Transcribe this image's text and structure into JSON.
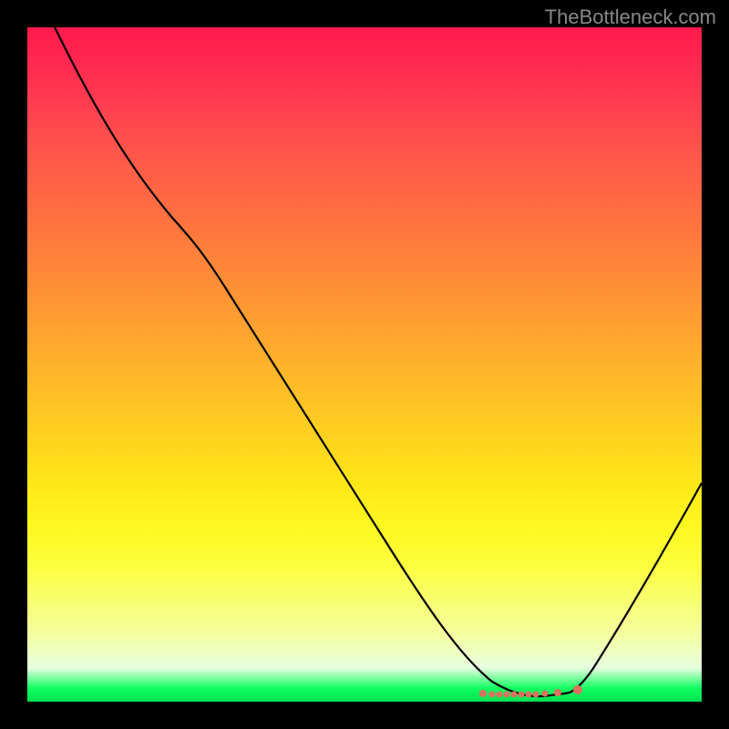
{
  "watermark": "TheBottleneck.com",
  "chart_data": {
    "type": "line",
    "title": "",
    "xlabel": "",
    "ylabel": "",
    "xlim": [
      0,
      100
    ],
    "ylim": [
      0,
      100
    ],
    "background_gradient": {
      "top": "#ff1a4d",
      "middle": "#ffd020",
      "bottom": "#00e050"
    },
    "series": [
      {
        "name": "curve",
        "color": "#000000",
        "x": [
          4,
          10,
          16,
          22,
          28,
          34,
          40,
          46,
          52,
          58,
          64,
          68,
          72,
          76,
          80,
          82,
          86,
          90,
          94,
          98,
          100
        ],
        "y": [
          100,
          90,
          80,
          72,
          65,
          56,
          47,
          38,
          30,
          22,
          14,
          8,
          4,
          1.5,
          0.5,
          1,
          5,
          12,
          22,
          33,
          40
        ]
      }
    ],
    "marker_points": {
      "x": [
        68,
        70,
        71,
        72,
        73,
        74,
        75,
        76,
        77,
        80,
        83
      ],
      "y": [
        1.0,
        1.0,
        1.0,
        1.0,
        1.0,
        1.0,
        1.0,
        1.0,
        1.0,
        1.0,
        1.2
      ],
      "color": "#e07060"
    }
  }
}
